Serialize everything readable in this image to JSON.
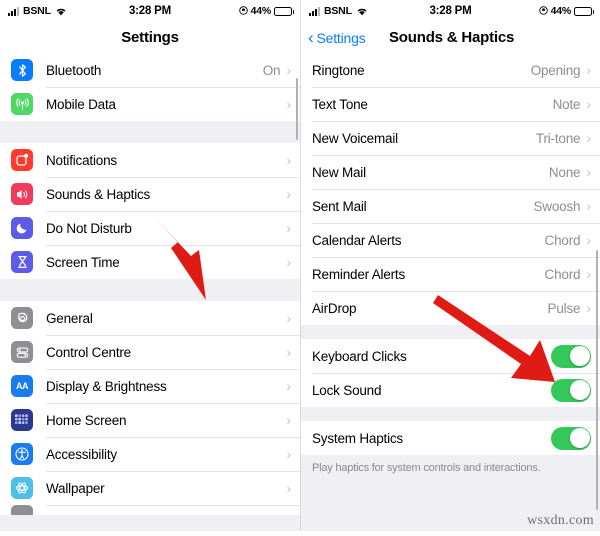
{
  "status_bar": {
    "carrier": "BSNL",
    "time": "3:28 PM",
    "battery_percent": "44%",
    "signal_icon": "signal-bars-icon",
    "wifi_icon": "wifi-icon",
    "orientation_lock_icon": "rotation-lock-icon",
    "battery_icon": "battery-icon"
  },
  "left_screen": {
    "nav": {
      "title": "Settings"
    },
    "groups": [
      {
        "rows": [
          {
            "icon": "bluetooth-icon",
            "label": "Bluetooth",
            "value": "On",
            "accessory": "chevron"
          },
          {
            "icon": "mobile-data-icon",
            "label": "Mobile Data",
            "value": "",
            "accessory": "chevron"
          }
        ]
      },
      {
        "rows": [
          {
            "icon": "notifications-icon",
            "label": "Notifications",
            "value": "",
            "accessory": "chevron"
          },
          {
            "icon": "sounds-haptics-icon",
            "label": "Sounds & Haptics",
            "value": "",
            "accessory": "chevron"
          },
          {
            "icon": "do-not-disturb-icon",
            "label": "Do Not Disturb",
            "value": "",
            "accessory": "chevron"
          },
          {
            "icon": "screen-time-icon",
            "label": "Screen Time",
            "value": "",
            "accessory": "chevron"
          }
        ]
      },
      {
        "rows": [
          {
            "icon": "general-icon",
            "label": "General",
            "value": "",
            "accessory": "chevron"
          },
          {
            "icon": "control-centre-icon",
            "label": "Control Centre",
            "value": "",
            "accessory": "chevron"
          },
          {
            "icon": "display-brightness-icon",
            "label": "Display & Brightness",
            "value": "",
            "accessory": "chevron"
          },
          {
            "icon": "home-screen-icon",
            "label": "Home Screen",
            "value": "",
            "accessory": "chevron"
          },
          {
            "icon": "accessibility-icon",
            "label": "Accessibility",
            "value": "",
            "accessory": "chevron"
          },
          {
            "icon": "wallpaper-icon",
            "label": "Wallpaper",
            "value": "",
            "accessory": "chevron"
          }
        ]
      }
    ]
  },
  "right_screen": {
    "nav": {
      "back_label": "Settings",
      "title": "Sounds & Haptics"
    },
    "groups": [
      {
        "rows": [
          {
            "label": "Ringtone",
            "value": "Opening",
            "accessory": "chevron"
          },
          {
            "label": "Text Tone",
            "value": "Note",
            "accessory": "chevron"
          },
          {
            "label": "New Voicemail",
            "value": "Tri-tone",
            "accessory": "chevron"
          },
          {
            "label": "New Mail",
            "value": "None",
            "accessory": "chevron"
          },
          {
            "label": "Sent Mail",
            "value": "Swoosh",
            "accessory": "chevron"
          },
          {
            "label": "Calendar Alerts",
            "value": "Chord",
            "accessory": "chevron"
          },
          {
            "label": "Reminder Alerts",
            "value": "Chord",
            "accessory": "chevron"
          },
          {
            "label": "AirDrop",
            "value": "Pulse",
            "accessory": "chevron"
          }
        ]
      },
      {
        "rows": [
          {
            "label": "Keyboard Clicks",
            "value": "",
            "accessory": "toggle",
            "toggle_on": true
          },
          {
            "label": "Lock Sound",
            "value": "",
            "accessory": "toggle",
            "toggle_on": true
          }
        ]
      },
      {
        "rows": [
          {
            "label": "System Haptics",
            "value": "",
            "accessory": "toggle",
            "toggle_on": true
          }
        ],
        "footnote": "Play haptics for system controls and interactions."
      }
    ]
  },
  "annotations": {
    "arrow_left_target": "Sounds & Haptics",
    "arrow_right_target": "Keyboard Clicks toggle",
    "arrow_color": "#e01b15"
  },
  "watermark": "wsxdn.com"
}
